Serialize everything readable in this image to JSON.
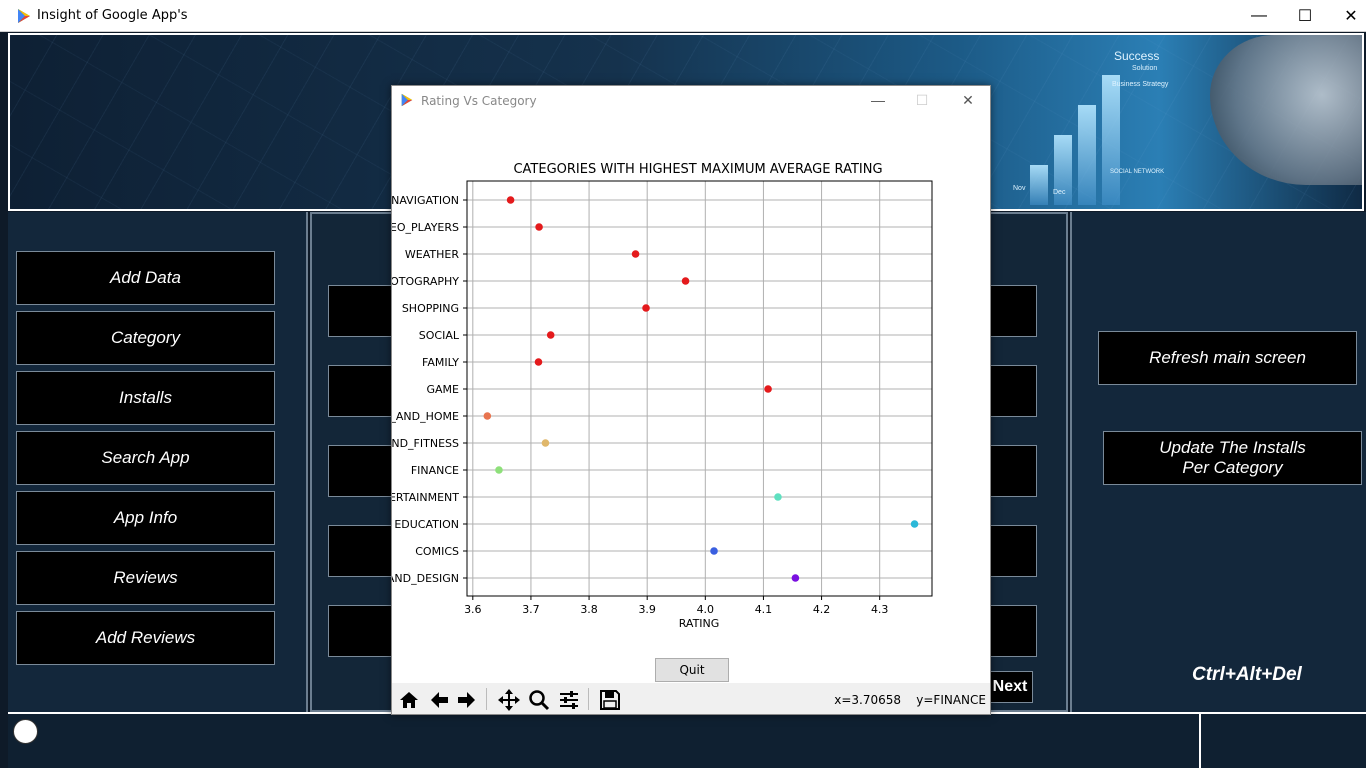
{
  "window": {
    "title": "Insight of Google App's",
    "minimize": "—",
    "maximize": "☐",
    "close": "✕"
  },
  "banner": {
    "texts": [
      "Success",
      "Solution",
      "Business Strategy",
      "SOCIAL NETWORK",
      "Nov",
      "Dec"
    ]
  },
  "left_menu": [
    {
      "label": "Add Data"
    },
    {
      "label": "Category"
    },
    {
      "label": "Installs"
    },
    {
      "label": "Search App"
    },
    {
      "label": "App Info"
    },
    {
      "label": "Reviews"
    },
    {
      "label": "Add Reviews"
    }
  ],
  "right_menu": {
    "refresh": "Refresh main screen",
    "update_line1": "Update The Installs",
    "update_line2": "Per Category",
    "shortcut": "Ctrl+Alt+Del"
  },
  "next_label": "Next",
  "chart_window": {
    "title": "Rating Vs Category",
    "quit_label": "Quit",
    "coords": "x=3.70658    y=FINANCE",
    "icons": [
      "home-icon",
      "back-arrow-icon",
      "forward-arrow-icon",
      "pan-icon",
      "zoom-icon",
      "configure-subplots-icon",
      "save-icon"
    ]
  },
  "chart_data": {
    "type": "scatter",
    "title": "CATEGORIES WITH HIGHEST MAXIMUM AVERAGE RATING",
    "xlabel": "RATING",
    "ylabel": "",
    "xlim": [
      3.59,
      4.39
    ],
    "xticks": [
      "3.6",
      "3.7",
      "3.8",
      "3.9",
      "4.0",
      "4.1",
      "4.2",
      "4.3"
    ],
    "grid": true,
    "categories": [
      "NAVIGATION",
      "EO_PLAYERS",
      "WEATHER",
      "OTOGRAPHY",
      "SHOPPING",
      "SOCIAL",
      "FAMILY",
      "GAME",
      "_AND_HOME",
      "ND_FITNESS",
      "FINANCE",
      "ERTAINMENT",
      "EDUCATION",
      "COMICS",
      "AND_DESIGN"
    ],
    "points": [
      {
        "category": "NAVIGATION",
        "x": 3.665,
        "color": "#e41a1c"
      },
      {
        "category": "EO_PLAYERS",
        "x": 3.714,
        "color": "#e41a1c"
      },
      {
        "category": "WEATHER",
        "x": 3.88,
        "color": "#e41a1c"
      },
      {
        "category": "OTOGRAPHY",
        "x": 3.966,
        "color": "#e41a1c"
      },
      {
        "category": "SHOPPING",
        "x": 3.898,
        "color": "#e41a1c"
      },
      {
        "category": "SOCIAL",
        "x": 3.734,
        "color": "#e41a1c"
      },
      {
        "category": "FAMILY",
        "x": 3.713,
        "color": "#e41a1c"
      },
      {
        "category": "GAME",
        "x": 4.108,
        "color": "#e41a1c"
      },
      {
        "category": "_AND_HOME",
        "x": 3.625,
        "color": "#e8744f"
      },
      {
        "category": "ND_FITNESS",
        "x": 3.725,
        "color": "#e0b76a"
      },
      {
        "category": "FINANCE",
        "x": 3.645,
        "color": "#8ee07a"
      },
      {
        "category": "ERTAINMENT",
        "x": 4.125,
        "color": "#5fe0c0"
      },
      {
        "category": "EDUCATION",
        "x": 4.36,
        "color": "#2bb8d8"
      },
      {
        "category": "COMICS",
        "x": 4.015,
        "color": "#3a5fe0"
      },
      {
        "category": "AND_DESIGN",
        "x": 4.155,
        "color": "#7a10e0"
      }
    ]
  }
}
